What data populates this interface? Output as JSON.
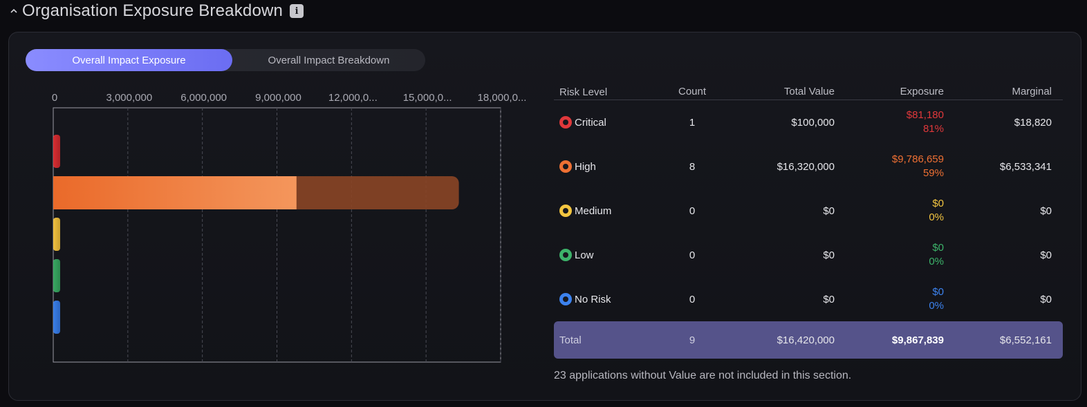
{
  "header": {
    "title": "Organisation Exposure Breakdown",
    "info_label": "i"
  },
  "toggle": {
    "active": "Overall Impact Exposure",
    "inactive": "Overall Impact Breakdown"
  },
  "table": {
    "headers": [
      "Risk Level",
      "Count",
      "Total Value",
      "Exposure",
      "Marginal"
    ],
    "rows": [
      {
        "level": "Critical",
        "count": "1",
        "total_value": "$100,000",
        "exposure": "$81,180",
        "exposure_pct": "81%",
        "marginal": "$18,820",
        "color": "#e0383b"
      },
      {
        "level": "High",
        "count": "8",
        "total_value": "$16,320,000",
        "exposure": "$9,786,659",
        "exposure_pct": "59%",
        "marginal": "$6,533,341",
        "color": "#ee7033"
      },
      {
        "level": "Medium",
        "count": "0",
        "total_value": "$0",
        "exposure": "$0",
        "exposure_pct": "0%",
        "marginal": "$0",
        "color": "#f3c540"
      },
      {
        "level": "Low",
        "count": "0",
        "total_value": "$0",
        "exposure": "$0",
        "exposure_pct": "0%",
        "marginal": "$0",
        "color": "#3db36a"
      },
      {
        "level": "No Risk",
        "count": "0",
        "total_value": "$0",
        "exposure": "$0",
        "exposure_pct": "0%",
        "marginal": "$0",
        "color": "#3c82ee"
      }
    ],
    "total": {
      "label": "Total",
      "count": "9",
      "total_value": "$16,420,000",
      "exposure": "$9,867,839",
      "marginal": "$6,552,161"
    }
  },
  "note": "23 applications without Value are not included in this section.",
  "chart_data": {
    "type": "bar",
    "orientation": "horizontal",
    "stacked": true,
    "xlim": [
      0,
      18000000
    ],
    "tick_labels": [
      "0",
      "3,000,000",
      "6,000,000",
      "9,000,000",
      "12,000,0...",
      "15,000,0...",
      "18,000,0..."
    ],
    "tick_values": [
      0,
      3000000,
      6000000,
      9000000,
      12000000,
      15000000,
      18000000
    ],
    "categories": [
      "Critical",
      "High",
      "Medium",
      "Low",
      "No Risk"
    ],
    "series": [
      {
        "values": [
          81180,
          9786659,
          0,
          0,
          0
        ]
      },
      {
        "values": [
          18820,
          6533341,
          0,
          0,
          0
        ]
      }
    ],
    "colors": [
      "#e0383b",
      "#ee7033",
      "#f3c540",
      "#3db36a",
      "#3c82ee"
    ],
    "grid": true
  }
}
